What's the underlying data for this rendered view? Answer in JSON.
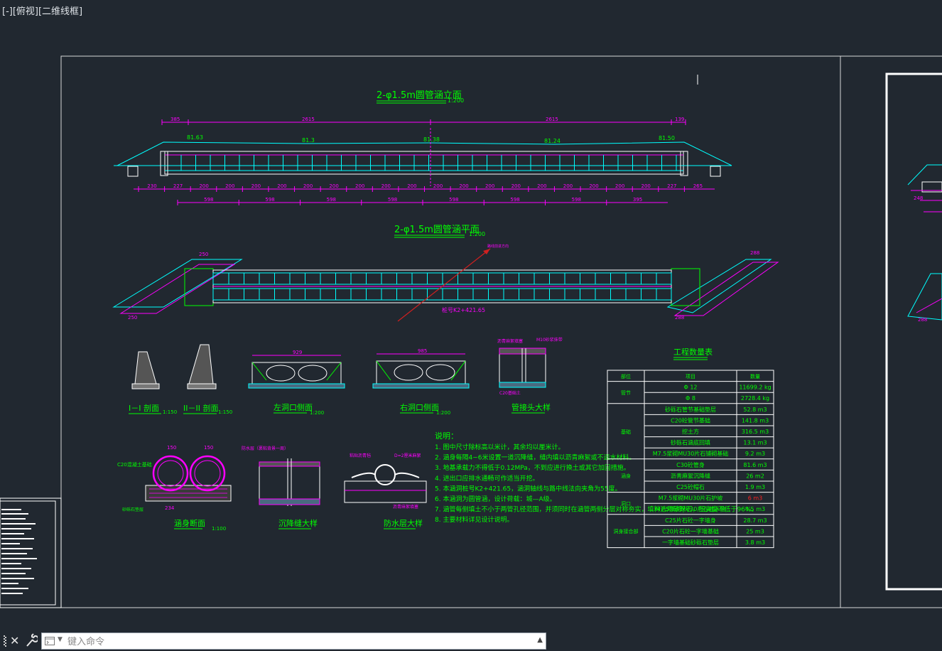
{
  "viewport": {
    "label": "[-][俯视][二维线框]"
  },
  "sheet": {
    "elevation_title": "2-φ1.5m圆管涵立面",
    "elevation_scale": "1:200",
    "plan_title": "2-φ1.5m圆管涵平面",
    "plan_scale": "1:200",
    "elevation_dims_top": [
      "385",
      "2615",
      "2615",
      "139"
    ],
    "elevation_levels": [
      "81.63",
      "81.3",
      "81.38",
      "81.24",
      "81.50"
    ],
    "elevation_dims_bottom": [
      "230",
      "227",
      "200",
      "200",
      "200",
      "200",
      "200",
      "200",
      "200",
      "200",
      "200",
      "200",
      "200",
      "200",
      "200",
      "200",
      "200",
      "200",
      "200",
      "200",
      "227",
      "265"
    ],
    "elevation_dims_bottom2": [
      "598",
      "598",
      "598",
      "598",
      "598",
      "598",
      "598",
      "395"
    ],
    "plan_station": "桩号K2+421.65",
    "plan_flow": "路线前进方向",
    "section_labels": {
      "s1": "I－I 剖面",
      "s1_scale": "1:150",
      "s2": "II－II 剖面",
      "s2_scale": "1:150",
      "left_face": "左洞口侧面",
      "left_face_scale": "1:200",
      "right_face": "右洞口侧面",
      "right_face_scale": "1:200",
      "joint": "管接头大样",
      "body": "涵身断面",
      "body_scale": "1:100",
      "settle": "沉降缝大样",
      "waterproof": "防水层大样"
    },
    "notes_title": "说明：",
    "notes": [
      "1. 图中尺寸除标高以米计，其余均以厘米计。",
      "2. 涵身每隔4~6米设置一道沉降缝，缝内填以沥青麻絮或不透水材料。",
      "3. 地基承载力不得低于0.12MPa，不到应进行换土或其它加固措施。",
      "4. 进出口应排水通畅可作适当开挖。",
      "5. 本涵洞桩号K2+421.65，涵洞轴线与路中线法向夹角为55度。",
      "6. 本涵洞为圆管涵，设计荷载：城—A级。",
      "7. 涵管每侧填土不小于两管孔径范围，并须同时在涵管两侧分层对称夯实，填料选用砂砾石，压实度不低于96%。",
      "8. 主要材料详见设计说明。"
    ],
    "table": {
      "title": "工程数量表",
      "headers": [
        "部位",
        "项目",
        "数量"
      ],
      "groups": [
        {
          "name": "管节",
          "rows": [
            [
              "Φ 12",
              "11699.2 kg"
            ],
            [
              "Φ 8",
              "2728.4 kg"
            ]
          ]
        },
        {
          "name": "基础",
          "rows": [
            [
              "砂砾石管节基础垫层",
              "52.8 m3"
            ],
            [
              "C20砼管节基础",
              "141.8 m3"
            ],
            [
              "挖土方",
              "316.5 m3"
            ],
            [
              "砂砾石涵底回填",
              "13.1 m3"
            ],
            [
              "M7.5浆砌MU30片石铺砌基础",
              "9.2 m3"
            ]
          ]
        },
        {
          "name": "涵身",
          "rows": [
            [
              "C30砼管身",
              "81.6 m3"
            ],
            [
              "沥青麻絮沉降缝",
              "26 m2"
            ],
            [
              "C25砼帽石",
              "1.9 m3"
            ]
          ]
        },
        {
          "name": "洞口",
          "rows": [
            [
              "M7.5浆砌MU30片石护坡",
              "6 m3"
            ],
            [
              "M7.5浆砌MU30片石截水墙",
              "4.5 m3"
            ]
          ]
        },
        {
          "name": "洞身接合部",
          "rows": [
            [
              "C25片石砼一字墙身",
              "28.7 m3"
            ],
            [
              "C20片石砼一字墙基础",
              "25 m3"
            ],
            [
              "一字墙基础砂砾石垫层",
              "3.8 m3"
            ]
          ]
        }
      ]
    }
  },
  "command": {
    "placeholder": "键入命令"
  },
  "colors": {
    "background": "#212830",
    "frame": "#d8d8d8",
    "magenta": "#ff00ff",
    "cyan": "#00ffff",
    "green": "#00ff00",
    "white": "#ffffff",
    "red": "#ff2020"
  }
}
